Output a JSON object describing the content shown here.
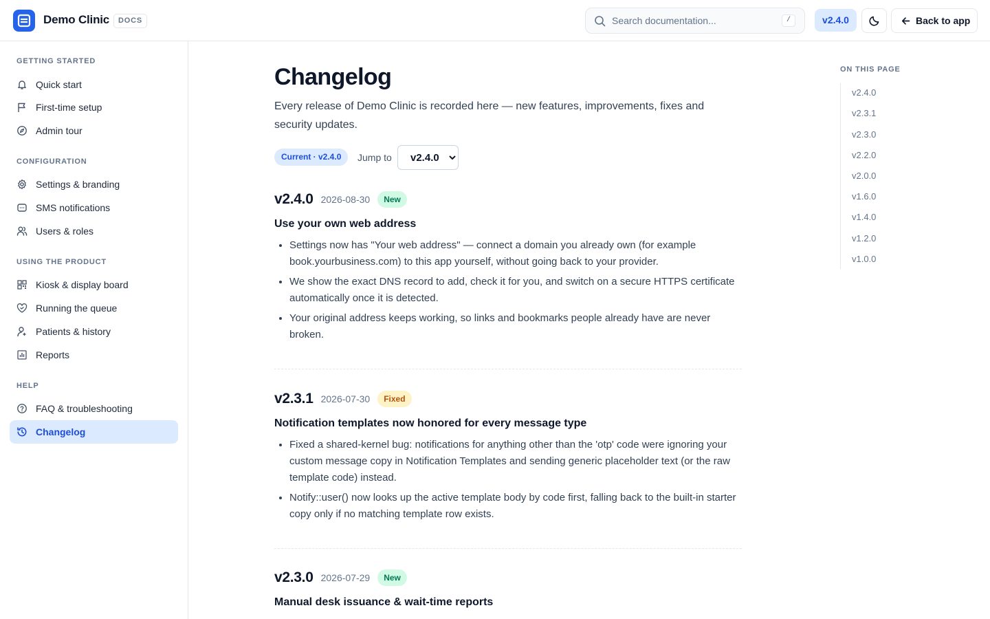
{
  "app": {
    "brand": "Demo Clinic",
    "badge": "DOCS",
    "search_placeholder": "Search documentation...",
    "search_shortcut": "/",
    "version": "v2.4.0",
    "back_label": "Back to app"
  },
  "sidebar": {
    "sections": [
      {
        "title": "GETTING STARTED",
        "items": [
          {
            "label": "Quick start",
            "icon": "bell-icon"
          },
          {
            "label": "First-time setup",
            "icon": "flag-icon"
          },
          {
            "label": "Admin tour",
            "icon": "compass-icon"
          }
        ]
      },
      {
        "title": "CONFIGURATION",
        "items": [
          {
            "label": "Settings & branding",
            "icon": "gear-icon"
          },
          {
            "label": "SMS notifications",
            "icon": "message-icon"
          },
          {
            "label": "Users & roles",
            "icon": "users-icon"
          }
        ]
      },
      {
        "title": "USING THE PRODUCT",
        "items": [
          {
            "label": "Kiosk & display board",
            "icon": "qr-icon"
          },
          {
            "label": "Running the queue",
            "icon": "heart-handshake-icon"
          },
          {
            "label": "Patients & history",
            "icon": "user-icon"
          },
          {
            "label": "Reports",
            "icon": "bar-chart-icon"
          }
        ]
      },
      {
        "title": "HELP",
        "items": [
          {
            "label": "FAQ & troubleshooting",
            "icon": "help-circle-icon"
          },
          {
            "label": "Changelog",
            "icon": "history-icon",
            "active": true
          }
        ]
      }
    ]
  },
  "main": {
    "title": "Changelog",
    "intro": "Every release of Demo Clinic is recorded here — new features, improvements, fixes and security updates.",
    "current_badge": "Current · v2.4.0",
    "jump_label": "Jump to",
    "jump_selected": "v2.4.0",
    "releases": [
      {
        "version": "v2.4.0",
        "date": "2026-08-30",
        "tag": "New",
        "title": "Use your own web address",
        "items": [
          "Settings now has \"Your web address\" — connect a domain you already own (for example book.yourbusiness.com) to this app yourself, without going back to your provider.",
          "We show the exact DNS record to add, check it for you, and switch on a secure HTTPS certificate automatically once it is detected.",
          "Your original address keeps working, so links and bookmarks people already have are never broken."
        ]
      },
      {
        "version": "v2.3.1",
        "date": "2026-07-30",
        "tag": "Fixed",
        "title": "Notification templates now honored for every message type",
        "items": [
          "Fixed a shared-kernel bug: notifications for anything other than the 'otp' code were ignoring your custom message copy in Notification Templates and sending generic placeholder text (or the raw template code) instead.",
          "Notify::user() now looks up the active template body by code first, falling back to the built-in starter copy only if no matching template row exists."
        ]
      },
      {
        "version": "v2.3.0",
        "date": "2026-07-29",
        "tag": "New",
        "title": "Manual desk issuance & wait-time reports",
        "items": []
      }
    ]
  },
  "toc": {
    "title": "ON THIS PAGE",
    "items": [
      "v2.4.0",
      "v2.3.1",
      "v2.3.0",
      "v2.2.0",
      "v2.0.0",
      "v1.6.0",
      "v1.4.0",
      "v1.2.0",
      "v1.0.0"
    ]
  },
  "colors": {
    "accent": "#2563eb",
    "accent_soft": "#dbeafe",
    "tag_new_bg": "#d1fae5",
    "tag_new_fg": "#047857",
    "tag_fixed_bg": "#fef3c7",
    "tag_fixed_fg": "#b45309"
  }
}
